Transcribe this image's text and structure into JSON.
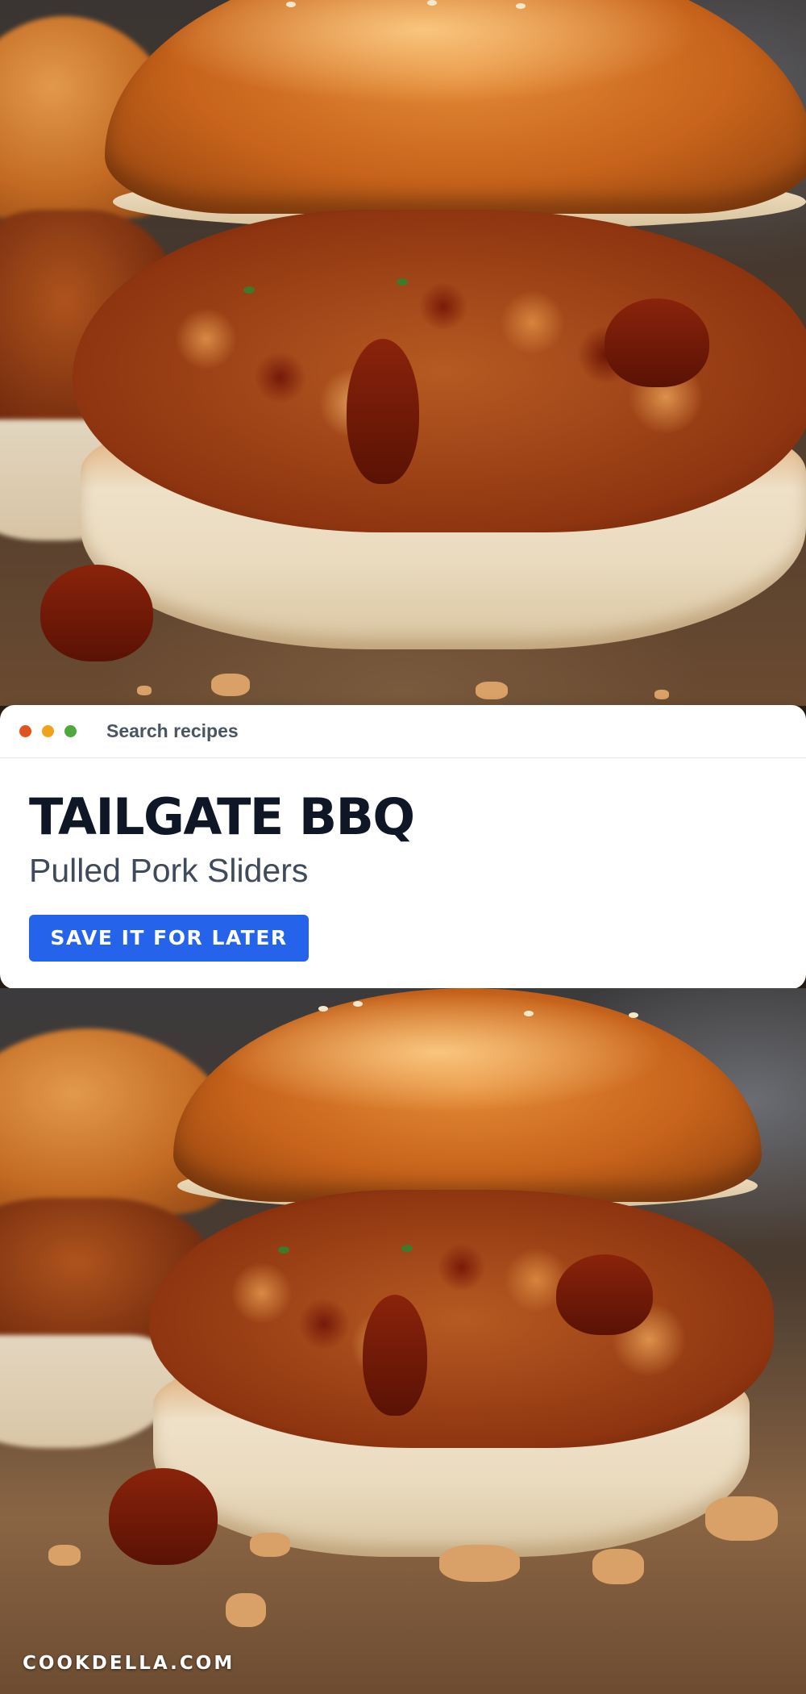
{
  "images": {
    "top_photo": {
      "icon": "pulled-pork-slider-photo"
    },
    "bottom_photo": {
      "icon": "pulled-pork-slider-photo"
    }
  },
  "window": {
    "dots": [
      {
        "name": "close-dot",
        "color": "#e0531f"
      },
      {
        "name": "minimize-dot",
        "color": "#f0a21a"
      },
      {
        "name": "maximize-dot",
        "color": "#4ea83b"
      }
    ],
    "search_label": "Search recipes"
  },
  "card": {
    "title": "TAILGATE BBQ",
    "subtitle": "Pulled Pork Sliders",
    "save_label": "SAVE IT FOR LATER"
  },
  "colors": {
    "accent": "#2563eb",
    "title": "#0f1626",
    "subtitle": "#3f4a5a",
    "search_label": "#4a5563"
  },
  "footer": {
    "domain": "COOKDELLA.COM"
  }
}
